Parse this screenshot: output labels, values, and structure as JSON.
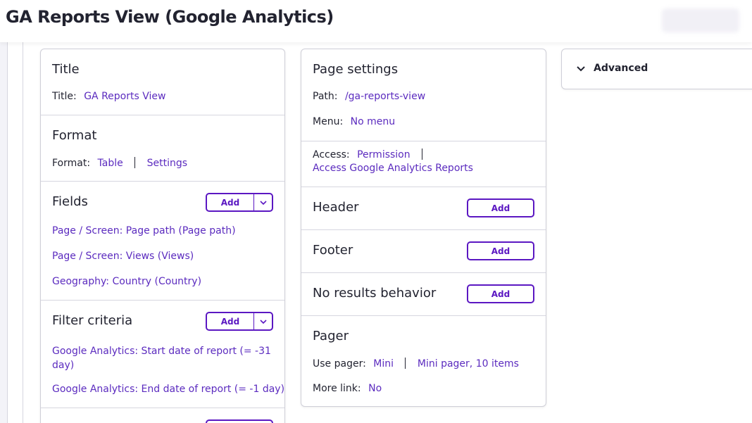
{
  "page": {
    "title": "GA Reports View (Google Analytics)"
  },
  "left": {
    "title_section": {
      "heading": "Title",
      "label": "Title:",
      "value": "GA Reports View"
    },
    "format_section": {
      "heading": "Format",
      "label": "Format:",
      "value": "Table",
      "settings": "Settings"
    },
    "fields_section": {
      "heading": "Fields",
      "add_label": "Add",
      "items": [
        "Page / Screen: Page path (Page path)",
        "Page / Screen: Views (Views)",
        "Geography: Country (Country)"
      ]
    },
    "filter_section": {
      "heading": "Filter criteria",
      "add_label": "Add",
      "items": [
        "Google Analytics: Start date of report (= -31",
        "day)",
        "Google Analytics: End date of report (= -1 day)"
      ]
    }
  },
  "middle": {
    "page_settings": {
      "heading": "Page settings",
      "path_label": "Path:",
      "path_value": "/ga-reports-view",
      "menu_label": "Menu:",
      "menu_value": "No menu"
    },
    "access": {
      "label": "Access:",
      "value": "Permission",
      "permission": "Access Google Analytics Reports"
    },
    "header": {
      "heading": "Header",
      "add_label": "Add"
    },
    "footer": {
      "heading": "Footer",
      "add_label": "Add"
    },
    "no_results": {
      "heading": "No results behavior",
      "add_label": "Add"
    },
    "pager": {
      "heading": "Pager",
      "use_label": "Use pager:",
      "use_value": "Mini",
      "pager_desc": "Mini pager, 10 items",
      "more_label": "More link:",
      "more_value": "No"
    }
  },
  "advanced": {
    "label": "Advanced"
  },
  "colors": {
    "accent": "#5b17c2",
    "link": "#5b2bbf"
  }
}
